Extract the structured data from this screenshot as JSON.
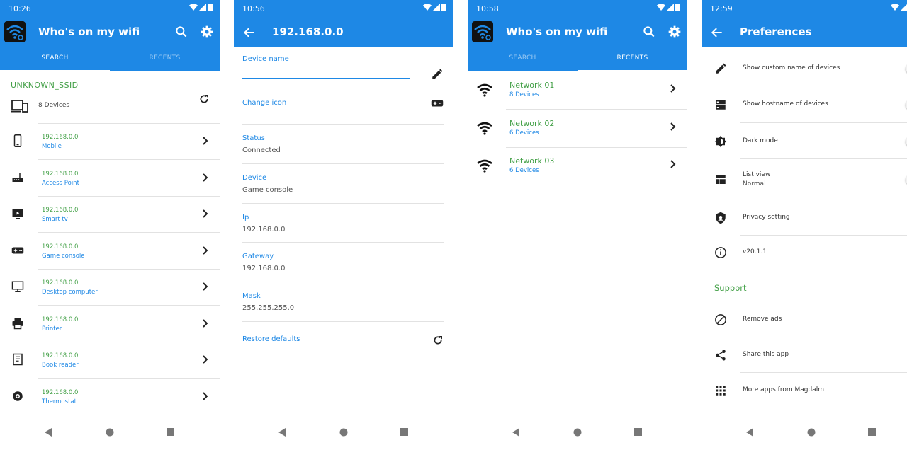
{
  "colors": {
    "primary": "#1e88e5",
    "accent_green": "#43a047",
    "text": "#333333"
  },
  "screen1": {
    "time": "10:26",
    "title": "Who's on my wifi",
    "tabs": [
      "SEARCH",
      "RECENTS"
    ],
    "ssid": "UNKNOWN_SSID",
    "device_count": "8 Devices",
    "devices": [
      {
        "ip": "192.168.0.0",
        "type": "Mobile",
        "icon": "smartphone-icon"
      },
      {
        "ip": "192.168.0.0",
        "type": "Access Point",
        "icon": "router-icon"
      },
      {
        "ip": "192.168.0.0",
        "type": "Smart tv",
        "icon": "tv-icon"
      },
      {
        "ip": "192.168.0.0",
        "type": "Game console",
        "icon": "gamepad-icon"
      },
      {
        "ip": "192.168.0.0",
        "type": "Desktop computer",
        "icon": "monitor-icon"
      },
      {
        "ip": "192.168.0.0",
        "type": "Printer",
        "icon": "printer-icon"
      },
      {
        "ip": "192.168.0.0",
        "type": "Book reader",
        "icon": "book-icon"
      },
      {
        "ip": "192.168.0.0",
        "type": "Thermostat",
        "icon": "thermostat-icon"
      }
    ]
  },
  "screen2": {
    "time": "10:56",
    "title": "192.168.0.0",
    "device_name_label": "Device name",
    "device_name_value": "",
    "change_icon_label": "Change icon",
    "fields": [
      {
        "label": "Status",
        "value": "Connected"
      },
      {
        "label": "Device",
        "value": "Game console"
      },
      {
        "label": "Ip",
        "value": "192.168.0.0"
      },
      {
        "label": "Gateway",
        "value": "192.168.0.0"
      },
      {
        "label": "Mask",
        "value": "255.255.255.0"
      }
    ],
    "restore_label": "Restore defaults"
  },
  "screen3": {
    "time": "10:58",
    "title": "Who's on my wifi",
    "tabs": [
      "SEARCH",
      "RECENTS"
    ],
    "networks": [
      {
        "name": "Network 01",
        "count": "8 Devices"
      },
      {
        "name": "Network 02",
        "count": "6 Devices"
      },
      {
        "name": "Network 03",
        "count": "6 Devices"
      }
    ]
  },
  "screen4": {
    "time": "12:59",
    "title": "Preferences",
    "prefs": [
      {
        "label": "Show custom name of devices",
        "sub": "",
        "icon": "pencil-icon",
        "toggle": true
      },
      {
        "label": "Show hostname of devices",
        "sub": "",
        "icon": "storage-icon",
        "toggle": true
      },
      {
        "label": "Dark mode",
        "sub": "",
        "icon": "brightness-icon",
        "toggle": true
      },
      {
        "label": "List view",
        "sub": "Normal",
        "icon": "list-view-icon",
        "toggle": true
      },
      {
        "label": "Privacy setting",
        "sub": "",
        "icon": "shield-icon",
        "chevron": true
      },
      {
        "label": "v20.1.1",
        "sub": "",
        "icon": "info-icon"
      }
    ],
    "support_heading": "Support",
    "support": [
      {
        "label": "Remove ads",
        "icon": "block-icon"
      },
      {
        "label": "Share this app",
        "icon": "share-icon"
      },
      {
        "label": "More apps from Magdalm",
        "icon": "apps-grid-icon"
      }
    ]
  }
}
